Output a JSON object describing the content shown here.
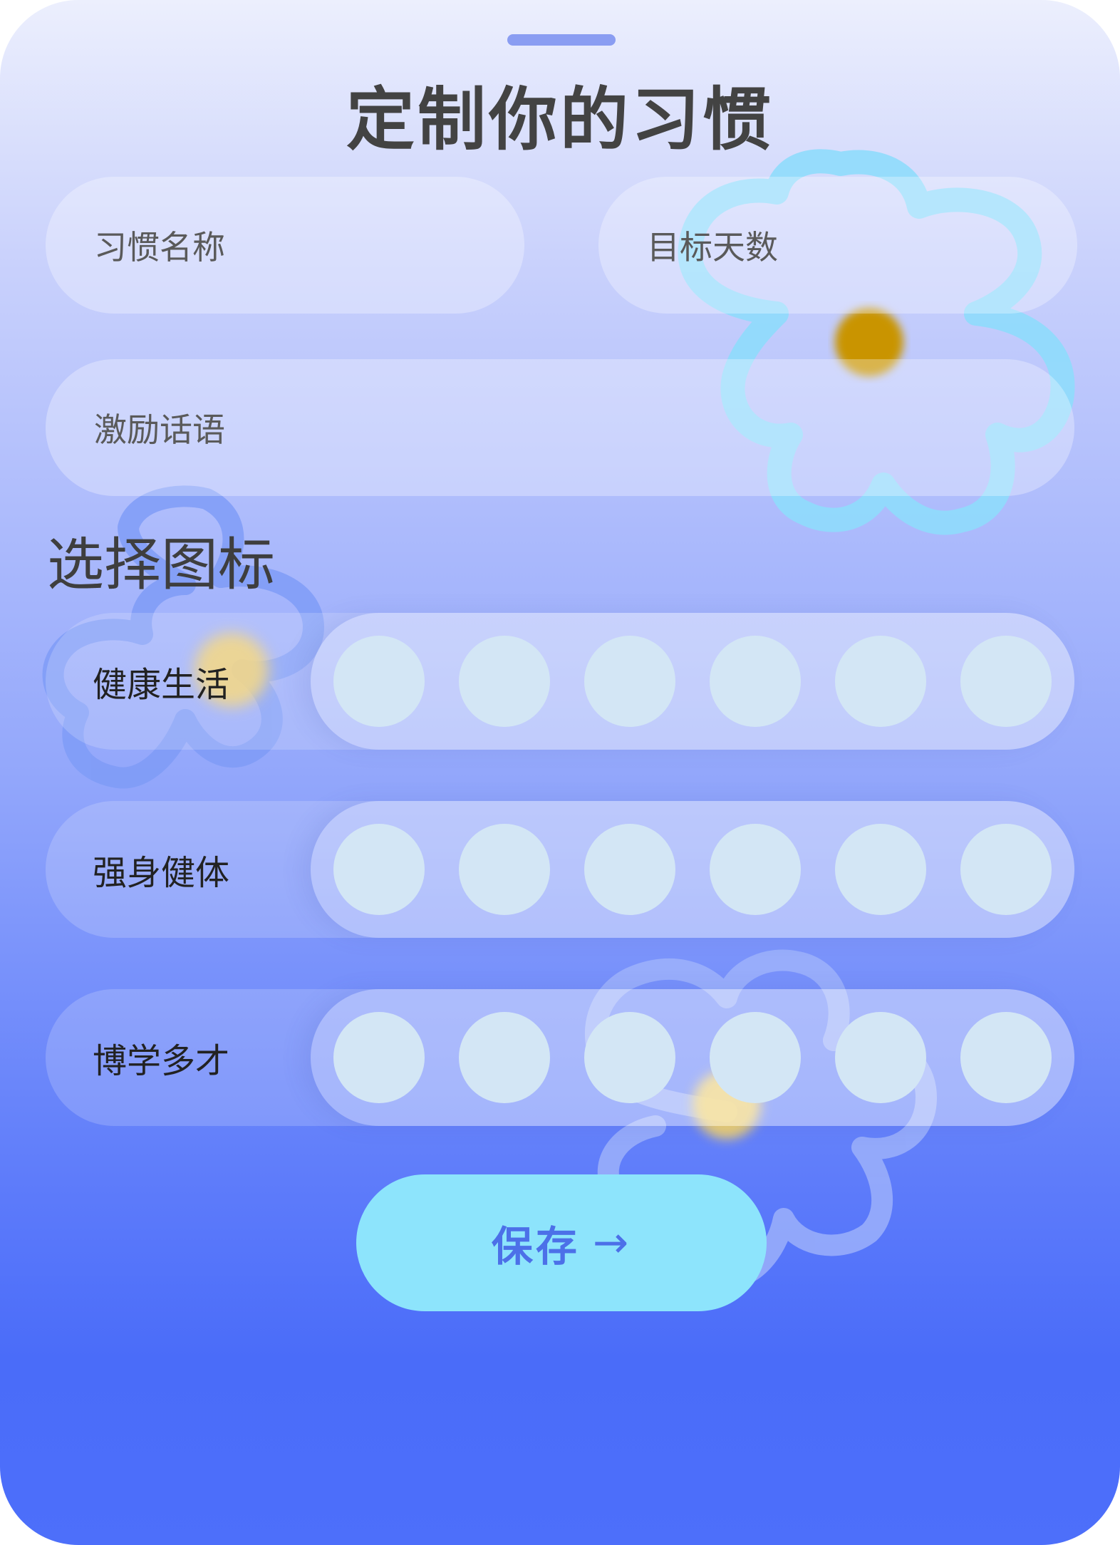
{
  "header": {
    "title": "定制你的习惯"
  },
  "form": {
    "habit_name_placeholder": "习惯名称",
    "target_days_placeholder": "目标天数",
    "motivation_placeholder": "激励话语"
  },
  "icons_section": {
    "title": "选择图标",
    "categories": [
      {
        "label": "健康生活",
        "slot_count": 6
      },
      {
        "label": "强身健体",
        "slot_count": 6
      },
      {
        "label": "博学多才",
        "slot_count": 6
      }
    ]
  },
  "actions": {
    "save_label": "保存",
    "save_arrow": "→"
  },
  "colors": {
    "background_top": "#eceffd",
    "background_bottom": "#4a6cf9",
    "icon_slot": "#d3e6f5",
    "save_button": "#8de4fc",
    "save_text": "#4c70e8",
    "flower_outline_light": "#8fdcfc",
    "flower_center_gold": "#c99400",
    "flower_center_yellow": "#f4d16a"
  }
}
